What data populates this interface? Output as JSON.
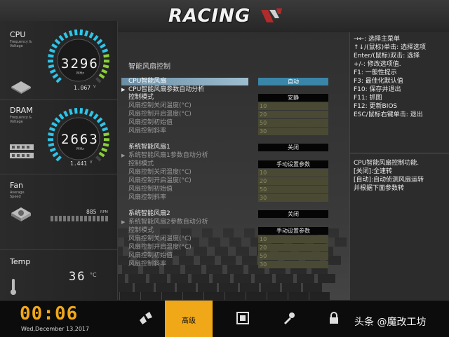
{
  "header": {
    "logo_text": "RACING"
  },
  "left_panel": {
    "cpu": {
      "title": "CPU",
      "sub1": "Frequency &",
      "sub2": "Voltage",
      "value": "3296",
      "unit": "MHz",
      "voltage": "1.067",
      "voltage_unit": "V"
    },
    "dram": {
      "title": "DRAM",
      "sub1": "Frequency &",
      "sub2": "Voltage",
      "value": "2663",
      "unit": "MHz",
      "voltage": "1.441",
      "voltage_unit": "V"
    },
    "fan": {
      "title": "Fan",
      "sub1": "Average",
      "sub2": "Speed",
      "value": "885",
      "unit": "RPM"
    },
    "temp": {
      "title": "Temp",
      "value": "36",
      "unit": "°C"
    }
  },
  "content": {
    "heading": "智能风扇控制",
    "rows": [
      {
        "label": "CPU智能风扇",
        "value": "自动",
        "style": "blue",
        "label_style": "highlight"
      },
      {
        "label": "CPU智能风扇参数自动分析",
        "label_style": "main",
        "arrow": "▶"
      },
      {
        "label": "控制模式",
        "value": "安静",
        "style": "black",
        "label_style": "main"
      },
      {
        "label": "风扇控制关闭温度(°C)",
        "value": "10",
        "style": "olive",
        "label_style": "sub"
      },
      {
        "label": "风扇控制开启温度(°C)",
        "value": "20",
        "style": "olive",
        "label_style": "sub"
      },
      {
        "label": "风扇控制初始值",
        "value": "50",
        "style": "olive",
        "label_style": "sub"
      },
      {
        "label": "风扇控制斜率",
        "value": "30",
        "style": "olive",
        "label_style": "sub"
      },
      {
        "label": "系统智能风扇1",
        "value": "关闭",
        "style": "black",
        "label_style": "main"
      },
      {
        "label": "系统智能风扇1参数自动分析",
        "label_style": "sub",
        "arrow": "▶"
      },
      {
        "label": "控制模式",
        "value": "手动设置参数",
        "style": "black",
        "label_style": "sub"
      },
      {
        "label": "风扇控制关闭温度(°C)",
        "value": "10",
        "style": "olive",
        "label_style": "sub"
      },
      {
        "label": "风扇控制开启温度(°C)",
        "value": "20",
        "style": "olive",
        "label_style": "sub"
      },
      {
        "label": "风扇控制初始值",
        "value": "50",
        "style": "olive",
        "label_style": "sub"
      },
      {
        "label": "风扇控制斜率",
        "value": "30",
        "style": "olive",
        "label_style": "sub"
      },
      {
        "label": "系统智能风扇2",
        "value": "关闭",
        "style": "black",
        "label_style": "main"
      },
      {
        "label": "系统智能风扇2参数自动分析",
        "label_style": "sub",
        "arrow": "▶"
      },
      {
        "label": "控制模式",
        "value": "手动设置参数",
        "style": "black",
        "label_style": "sub"
      },
      {
        "label": "风扇控制关闭温度(°C)",
        "value": "10",
        "style": "olive",
        "label_style": "sub"
      },
      {
        "label": "风扇控制开启温度(°C)",
        "value": "20",
        "style": "olive",
        "label_style": "sub"
      },
      {
        "label": "风扇控制初始值",
        "value": "50",
        "style": "olive",
        "label_style": "sub"
      },
      {
        "label": "风扇控制斜率",
        "value": "30",
        "style": "olive",
        "label_style": "sub"
      }
    ]
  },
  "right_panel": {
    "keys": [
      "→←: 选择主菜单",
      "↑↓/(鼠标)单击: 选择选项",
      "Enter/(鼠标)双击: 选择",
      "+/-: 修改选项值.",
      "F1: 一般性提示",
      "F3: 最佳化默认值",
      "F10: 保存并退出",
      "F11: 抓图",
      "F12: 更新BIOS",
      "ESC/鼠标右键单击: 退出"
    ],
    "help": [
      "CPU智能风扇控制功能.",
      "[关闭]:全速转",
      "[自动]:自动侦测风扇运转",
      "并根据下面参数转"
    ]
  },
  "bottom_bar": {
    "clock": "00:06",
    "date": "Wed,December  13,2017",
    "active_tab": "高级",
    "watermark": "头条 @魔改工坊",
    "icons": [
      "overclock-icon",
      "advanced-tab",
      "chip-icon",
      "tool-icon",
      "lock-icon"
    ]
  },
  "colors": {
    "accent": "#f0a818",
    "selected_value": "#3a86a8",
    "gauge_cyan": "#2ec4e8",
    "gauge_green": "#8ad03a"
  }
}
